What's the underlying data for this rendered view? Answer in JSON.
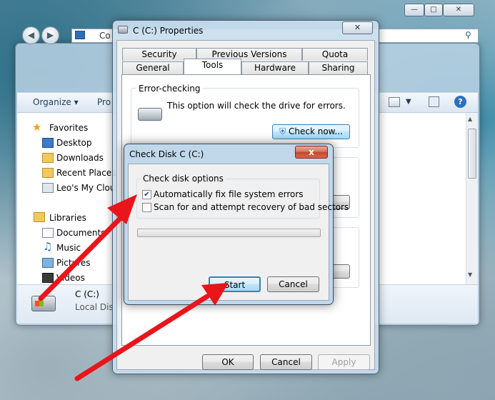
{
  "explorer": {
    "address_partial": "Co",
    "toolbar": {
      "organize": "Organize",
      "second_partial": "Pro"
    },
    "nav": {
      "favorites": "Favorites",
      "desktop": "Desktop",
      "downloads": "Downloads",
      "recent": "Recent Places",
      "cloud": "Leo's My Clouc",
      "libraries": "Libraries",
      "documents": "Documents",
      "music": "Music",
      "pictures": "Pictures",
      "videos": "Videos"
    },
    "details": {
      "drive_name": "C (C:)",
      "drive_type": "Local Disk"
    }
  },
  "properties": {
    "title": "C (C:) Properties",
    "tabs_back": [
      "Security",
      "Previous Versions",
      "Quota"
    ],
    "tabs_front": [
      "General",
      "Tools",
      "Hardware",
      "Sharing"
    ],
    "active_tab": "Tools",
    "error_checking": {
      "heading": "Error-checking",
      "description": "This option will check the drive for errors.",
      "button": "Check now..."
    },
    "buttons": {
      "ok": "OK",
      "cancel": "Cancel",
      "apply": "Apply"
    }
  },
  "check_disk": {
    "title": "Check Disk C (C:)",
    "close": "x",
    "group_label": "Check disk options",
    "options": [
      {
        "label": "Automatically fix file system errors",
        "checked": true
      },
      {
        "label": "Scan for and attempt recovery of bad sectors",
        "checked": false
      }
    ],
    "progress": 0,
    "buttons": {
      "start": "Start",
      "cancel": "Cancel"
    }
  },
  "colors": {
    "annotation_arrow": "#e8151b",
    "progress_fill": "#37b03a"
  }
}
